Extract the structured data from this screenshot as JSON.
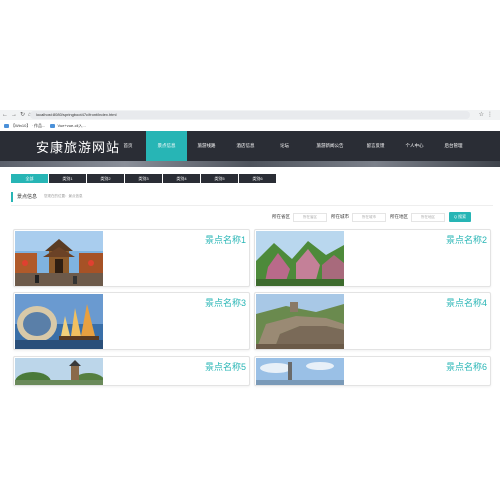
{
  "browser": {
    "url": "localhost:8080/springboot47c/front/index.html",
    "bookmarks": [
      "【Win10】ㆍ作品...",
      "Vue+vue-cli入..."
    ]
  },
  "site": {
    "title": "安康旅游网站"
  },
  "menu": [
    {
      "label": "首页",
      "active": false
    },
    {
      "label": "景点信息",
      "active": true
    },
    {
      "label": "旅游线路",
      "active": false
    },
    {
      "label": "酒店信息",
      "active": false
    },
    {
      "label": "论坛",
      "active": false
    },
    {
      "label": "旅游新闻公告",
      "active": false
    },
    {
      "label": "留言反馈",
      "active": false
    },
    {
      "label": "个人中心",
      "active": false
    },
    {
      "label": "后台管理",
      "active": false
    }
  ],
  "tabs": [
    {
      "label": "全部",
      "active": true
    },
    {
      "label": "类别1",
      "active": false
    },
    {
      "label": "类别2",
      "active": false
    },
    {
      "label": "类别3",
      "active": false
    },
    {
      "label": "类别4",
      "active": false
    },
    {
      "label": "类别5",
      "active": false
    },
    {
      "label": "类别6",
      "active": false
    }
  ],
  "breadcrumb": {
    "title": "景点信息",
    "path": "您现在的位置：景点信息"
  },
  "filters": [
    {
      "label": "所在省区",
      "placeholder": "所在省区"
    },
    {
      "label": "所在城市",
      "placeholder": "所在城市"
    },
    {
      "label": "所在地区",
      "placeholder": "所在地区"
    }
  ],
  "search_button": "Q 搜索",
  "cards": [
    {
      "name": "景点名称1"
    },
    {
      "name": "景点名称2"
    },
    {
      "name": "景点名称3"
    },
    {
      "name": "景点名称4"
    },
    {
      "name": "景点名称5"
    },
    {
      "name": "景点名称6"
    }
  ],
  "colors": {
    "accent": "#27b5b5",
    "header_bg": "#2a2d35"
  }
}
